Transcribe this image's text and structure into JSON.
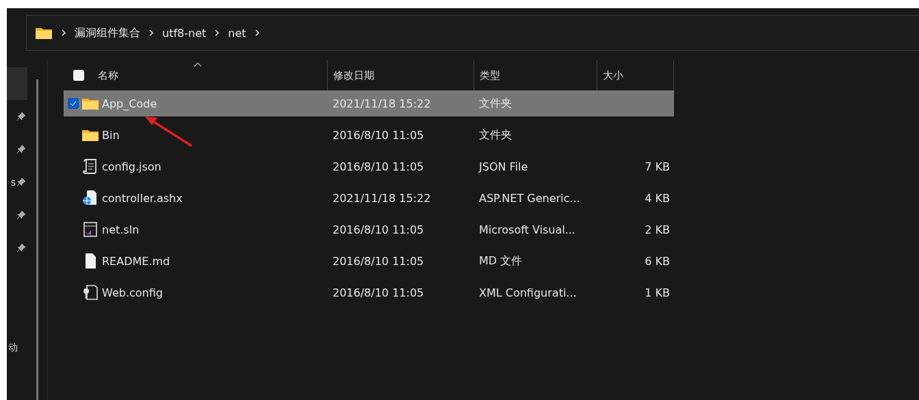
{
  "breadcrumb": [
    "漏洞组件集合",
    "utf8-net",
    "net"
  ],
  "sidebar": {
    "items": [
      {
        "pinned": false,
        "selected": true
      },
      {
        "pinned": true,
        "selected": false
      },
      {
        "pinned": true,
        "selected": false
      },
      {
        "label": "s",
        "pinned": true,
        "selected": false
      },
      {
        "pinned": true,
        "selected": false
      },
      {
        "pinned": true,
        "selected": false
      }
    ],
    "footer": "动"
  },
  "table": {
    "select_all": {
      "checked": false
    },
    "columns": [
      "名称",
      "修改日期",
      "类型",
      "大小"
    ],
    "rows": [
      {
        "name": "App_Code",
        "date": "2021/11/18 15:22",
        "type": "文件夹",
        "kind": "folder",
        "selected": true
      },
      {
        "name": "Bin",
        "date": "2016/8/10 11:05",
        "type": "文件夹",
        "kind": "folder",
        "selected": false
      },
      {
        "name": "config.json",
        "date": "2016/8/10 11:05",
        "type": "JSON File",
        "size": "7 KB",
        "kind": "script",
        "selected": false
      },
      {
        "name": "controller.ashx",
        "date": "2021/11/18 15:22",
        "type": "ASP.NET Generic...",
        "size": "4 KB",
        "kind": "web",
        "selected": false
      },
      {
        "name": "net.sln",
        "date": "2016/8/10 11:05",
        "type": "Microsoft Visual...",
        "size": "2 KB",
        "kind": "solution",
        "selected": false
      },
      {
        "name": "README.md",
        "date": "2016/8/10 11:05",
        "type": "MD 文件",
        "size": "6 KB",
        "kind": "document",
        "selected": false
      },
      {
        "name": "Web.config",
        "date": "2016/8/10 11:05",
        "type": "XML Configurati...",
        "size": "1 KB",
        "kind": "config",
        "selected": false
      }
    ]
  }
}
